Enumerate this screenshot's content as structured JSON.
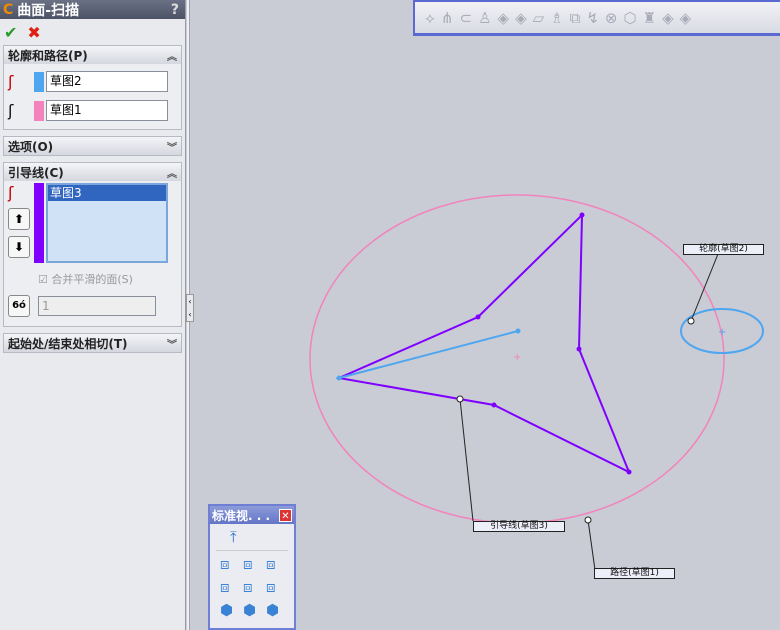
{
  "panel": {
    "title": "曲面-扫描",
    "help": "?",
    "ok": "✔",
    "cancel": "✖",
    "sections": {
      "profile_path": {
        "header": "轮廓和路径(P)",
        "profile": "草图2",
        "path": "草图1",
        "profile_color": "#4ea6f0",
        "path_color": "#f283bd"
      },
      "options": {
        "header": "选项(O)"
      },
      "guides": {
        "header": "引导线(C)",
        "items": [
          "草图3"
        ],
        "color": "#7f00ff",
        "merge_label": "合并平滑的面(S)",
        "merge_checked": true,
        "spin_value": "1"
      },
      "tangency": {
        "header": "起始处/结束处相切(T)"
      }
    }
  },
  "toolbar": {
    "icons": [
      "swept-boss-icon",
      "revolve-icon",
      "extrude-icon",
      "loft-icon",
      "surface-icon",
      "offset-surface-icon",
      "planar-surface-icon",
      "boundary-icon",
      "knit-icon",
      "fillet-icon",
      "delete-face-icon",
      "thicken-icon",
      "split-icon",
      "move-face-icon",
      "extend-icon"
    ]
  },
  "viewport": {
    "callouts": {
      "profile": "轮廓(草图2)",
      "guide": "引导线(草图3)",
      "path": "路径(草图1)"
    }
  },
  "views_popup": {
    "title": "标准视. . .",
    "close": "✕"
  }
}
